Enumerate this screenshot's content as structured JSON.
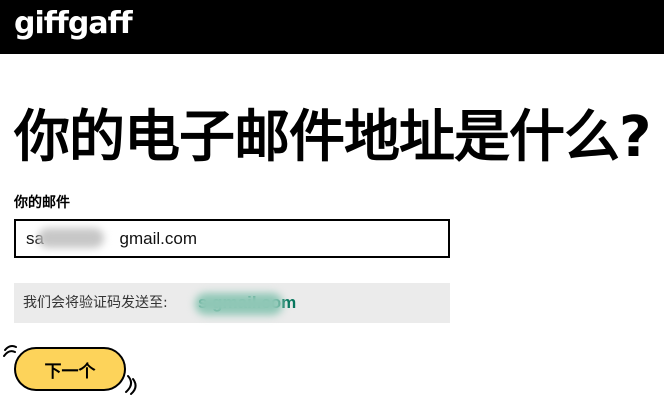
{
  "header": {
    "logo_text": "giffgaff",
    "background": "#000000"
  },
  "main": {
    "heading": "你的电子邮件地址是什么?",
    "email_label": "你的邮件",
    "email_value": "sa                gmail.com",
    "notice_text": "我们会将验证码发送至:",
    "notice_email": "s                  gmail.com",
    "notice_email_color": "#08775e",
    "next_button_label": "下一个",
    "next_button_color": "#fdd35a"
  }
}
